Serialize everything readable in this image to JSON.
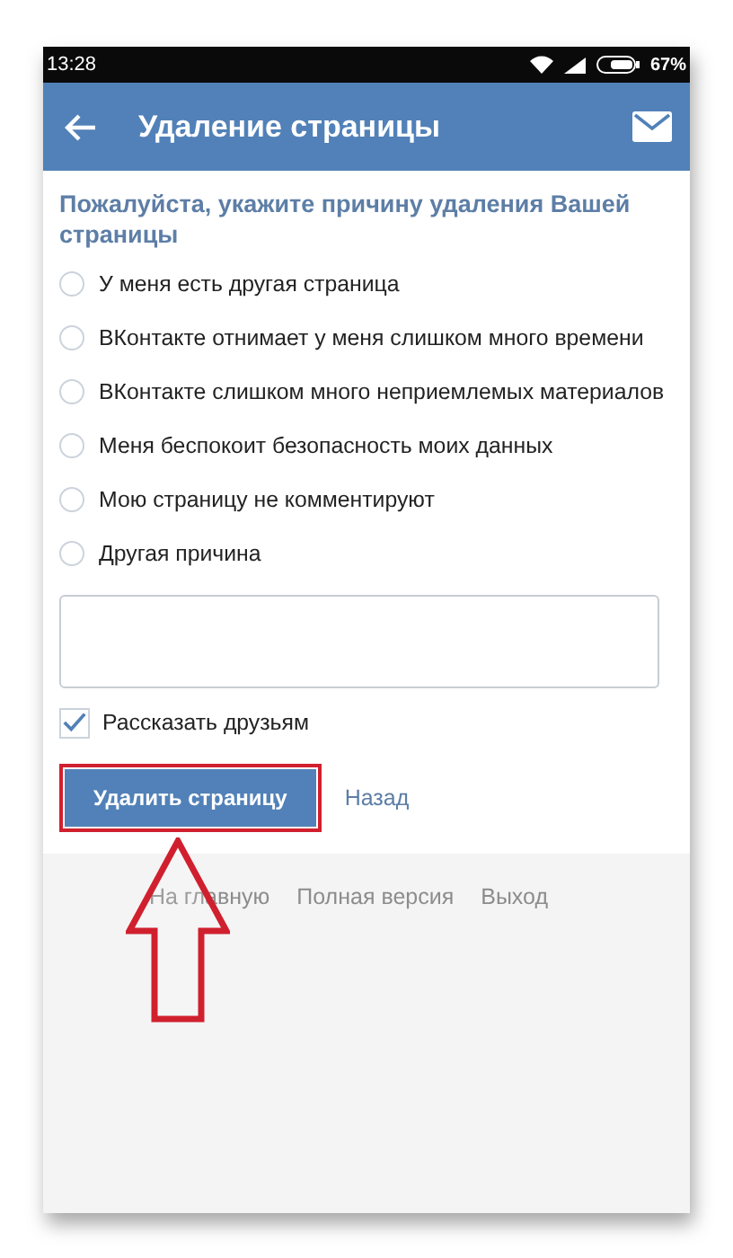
{
  "status_bar": {
    "time": "13:28",
    "battery": "67%"
  },
  "header": {
    "title": "Удаление страницы"
  },
  "form": {
    "prompt": "Пожалуйста, укажите причину удаления Вашей страницы",
    "reasons": [
      {
        "label": "У меня есть другая страница",
        "selected": false
      },
      {
        "label": "ВКонтакте отнимает у меня слишком много времени",
        "selected": false
      },
      {
        "label": "ВКонтакте слишком много неприемлемых материалов",
        "selected": false
      },
      {
        "label": "Меня беспокоит безопасность моих данных",
        "selected": false
      },
      {
        "label": "Мою страницу не комментируют",
        "selected": false
      },
      {
        "label": "Другая причина",
        "selected": false
      }
    ],
    "share": {
      "label": "Рассказать друзьям",
      "checked": true
    },
    "delete_button": "Удалить страницу",
    "back_link": "Назад"
  },
  "footer_links": [
    "На главную",
    "Полная версия",
    "Выход"
  ]
}
